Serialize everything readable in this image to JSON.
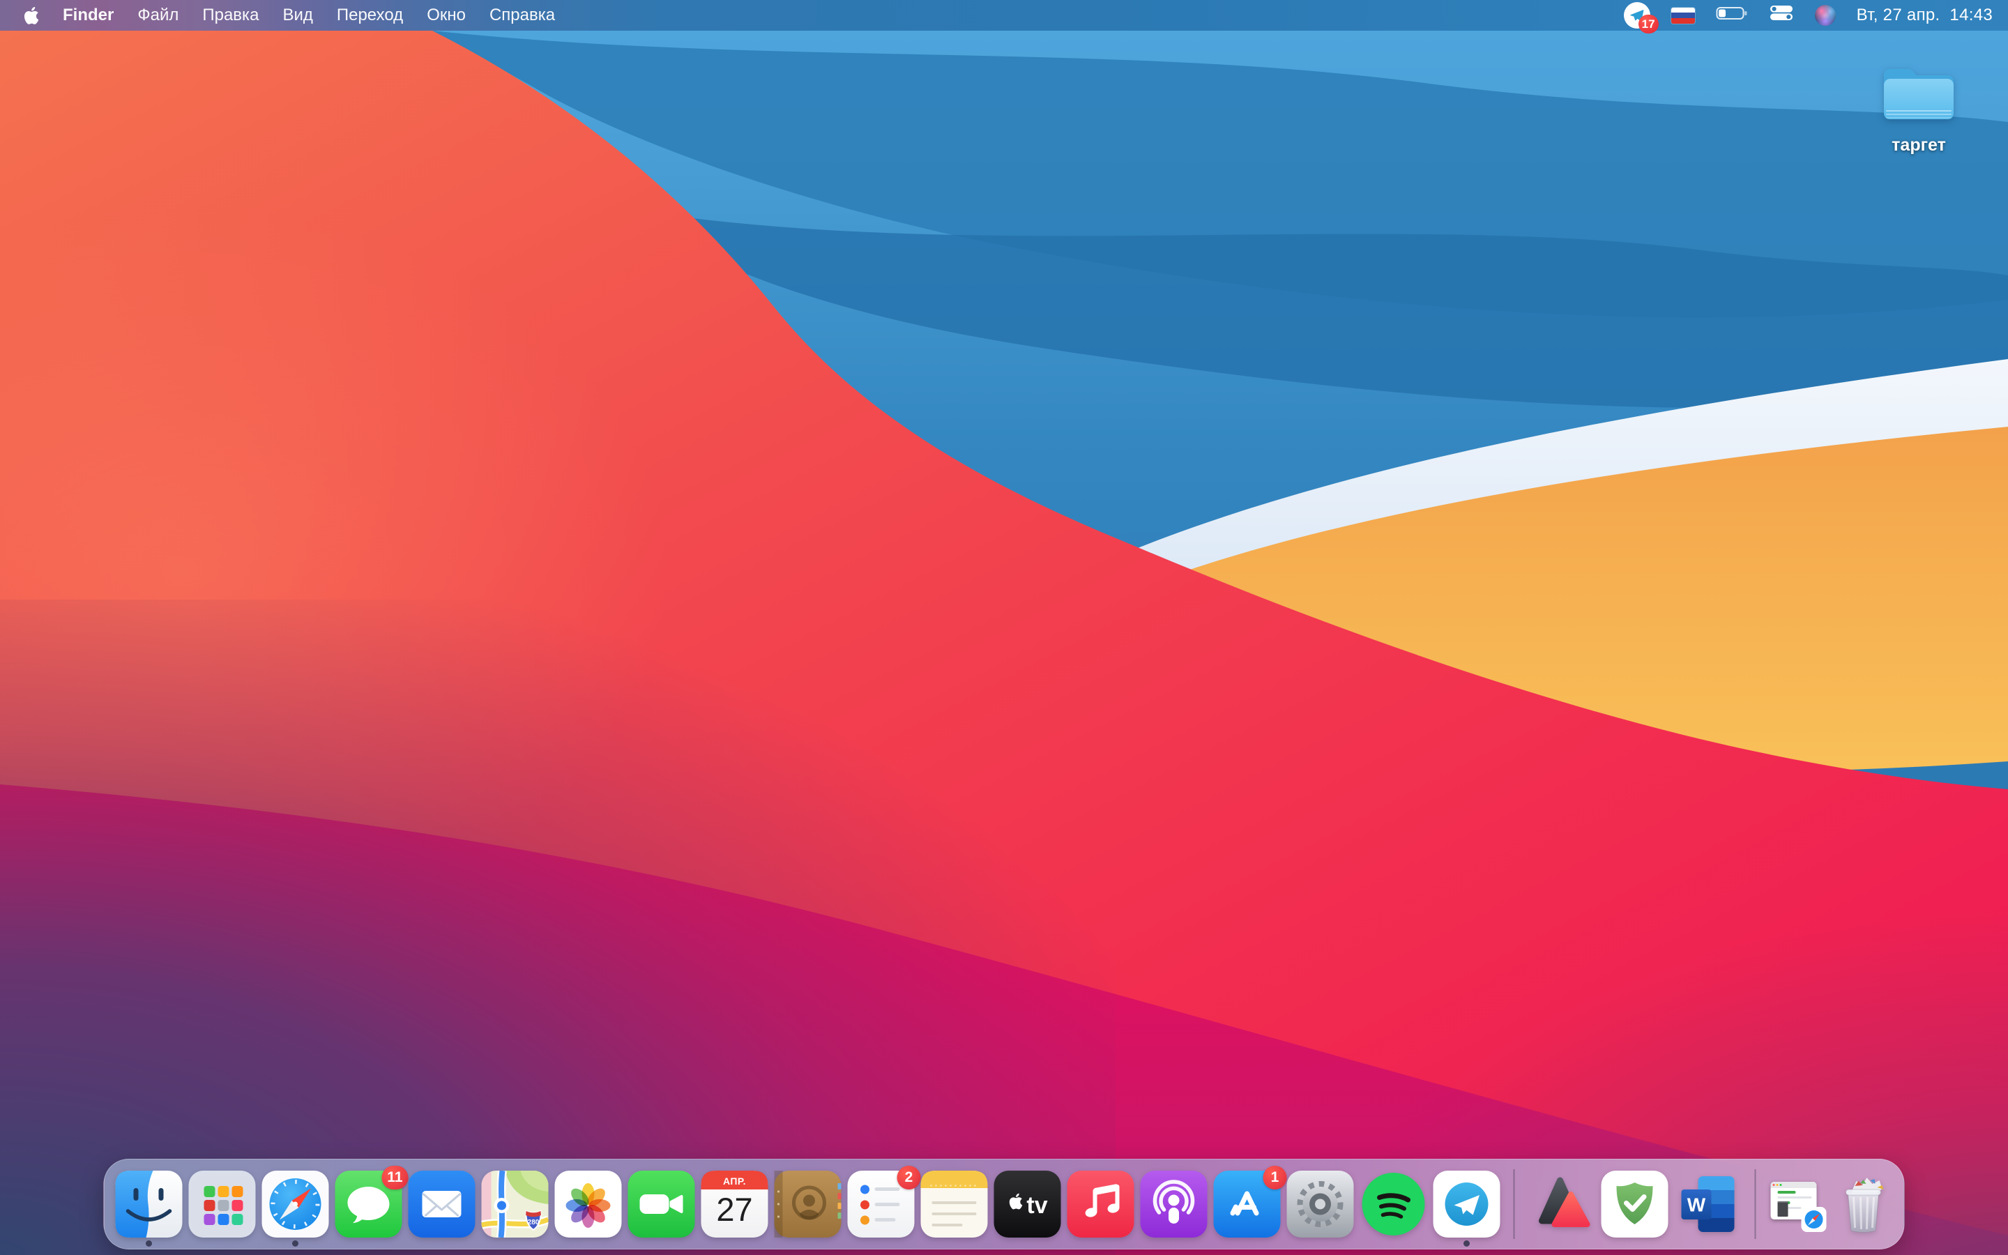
{
  "menu_bar": {
    "items": [
      "Finder",
      "Файл",
      "Правка",
      "Вид",
      "Переход",
      "Окно",
      "Справка"
    ],
    "active_app": "Finder",
    "status": {
      "telegram_badge": "17",
      "input_language": "russian-flag",
      "battery_level_percent": 25,
      "icons": [
        "telegram",
        "input-language-flag",
        "battery",
        "control-center",
        "siri"
      ],
      "clock": "Вт, 27 апр.  14:43"
    }
  },
  "desktop": {
    "folder_label": "таргет",
    "wallpaper": "macos-big-sur-colorful-waves"
  },
  "dock": {
    "items": [
      {
        "icon": "finder",
        "running": true
      },
      {
        "icon": "launchpad",
        "running": false
      },
      {
        "icon": "safari",
        "running": true
      },
      {
        "icon": "messages",
        "running": false,
        "badge": "11"
      },
      {
        "icon": "mail",
        "running": false
      },
      {
        "icon": "maps",
        "running": false
      },
      {
        "icon": "photos",
        "running": false
      },
      {
        "icon": "facetime",
        "running": false
      },
      {
        "icon": "calendar",
        "running": false,
        "month": "АПР.",
        "day": "27"
      },
      {
        "icon": "contacts",
        "running": false
      },
      {
        "icon": "reminders",
        "running": false,
        "badge": "2"
      },
      {
        "icon": "notes",
        "running": false
      },
      {
        "icon": "apple-tv",
        "running": false
      },
      {
        "icon": "music",
        "running": false
      },
      {
        "icon": "podcasts",
        "running": false
      },
      {
        "icon": "app-store",
        "running": false,
        "badge": "1"
      },
      {
        "icon": "system-preferences",
        "running": false
      },
      {
        "icon": "spotify",
        "running": false
      },
      {
        "icon": "telegram",
        "running": true
      },
      {
        "icon": "separator"
      },
      {
        "icon": "gemini-triangles-app",
        "running": false
      },
      {
        "icon": "adguard",
        "running": false
      },
      {
        "icon": "microsoft-word",
        "running": false
      },
      {
        "icon": "separator"
      },
      {
        "icon": "minimized-safari-window",
        "running": false
      },
      {
        "icon": "trash",
        "full": true
      }
    ],
    "labels": {
      "tv": "tv",
      "word": "W",
      "maps_shield": "280"
    }
  },
  "colors": {
    "badge_red": "#e8343f",
    "menu_text": "#ffffff",
    "folder_blue": "#6ec6ef",
    "dock_left": "#8d96bc",
    "dock_right": "#cda6cd",
    "wallpaper_sky": "#3487c1",
    "wallpaper_red": "#f2424f",
    "wallpaper_orange": "#f6b053",
    "wallpaper_white_band": "#eef4fb",
    "wallpaper_magenta": "#ee1058",
    "wallpaper_purple_corner": "#3f4f7c"
  }
}
